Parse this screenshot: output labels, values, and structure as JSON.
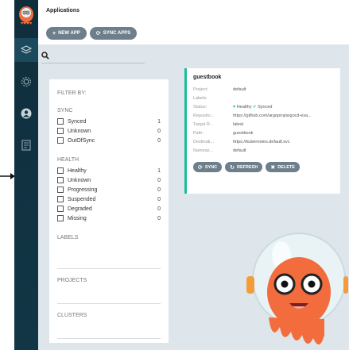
{
  "header": {
    "title": "Applications",
    "new_app_label": "NEW APP",
    "sync_apps_label": "SYNC APPS"
  },
  "filter": {
    "heading": "FILTER BY:",
    "sync_title": "SYNC",
    "sync_items": [
      {
        "label": "Synced",
        "count": "1"
      },
      {
        "label": "Unknown",
        "count": "0"
      },
      {
        "label": "OutOfSync",
        "count": "0"
      }
    ],
    "health_title": "HEALTH",
    "health_items": [
      {
        "label": "Healthy",
        "count": "1"
      },
      {
        "label": "Unknown",
        "count": "0"
      },
      {
        "label": "Progressing",
        "count": "0"
      },
      {
        "label": "Suspended",
        "count": "0"
      },
      {
        "label": "Degraded",
        "count": "0"
      },
      {
        "label": "Missing",
        "count": "0"
      }
    ],
    "labels_title": "LABELS",
    "projects_title": "PROJECTS",
    "clusters_title": "CLUSTERS"
  },
  "app_card": {
    "name": "guestbook",
    "fields": [
      {
        "key": "Project:",
        "value": "default"
      },
      {
        "key": "Labels:",
        "value": ""
      },
      {
        "key": "Status:",
        "value": ""
      },
      {
        "key": "Reposito...",
        "value": "https://github.com/argoproj/argocd-exa..."
      },
      {
        "key": "Target R...",
        "value": "latest"
      },
      {
        "key": "Path:",
        "value": "guestbook"
      },
      {
        "key": "Destinati...",
        "value": "https://kubernetes.default.svc"
      },
      {
        "key": "Namesp...",
        "value": "default"
      }
    ],
    "health_status": "Healthy",
    "sync_status": "Synced",
    "sync_label": "SYNC",
    "refresh_label": "REFRESH",
    "delete_label": "DELETE"
  },
  "colors": {
    "nav_bg": "#0f2e3c",
    "main_bg": "#dee6eb",
    "pill": "#6d7f8b",
    "accent_green": "#18be94",
    "mascot_orange": "#f26c3d"
  },
  "icons": [
    "argo-logo-icon",
    "layers-icon",
    "gear-icon",
    "user-icon",
    "docs-icon",
    "search-icon",
    "plus-icon",
    "sync-icon",
    "refresh-icon",
    "delete-icon",
    "heart-icon",
    "check-circle-icon"
  ]
}
